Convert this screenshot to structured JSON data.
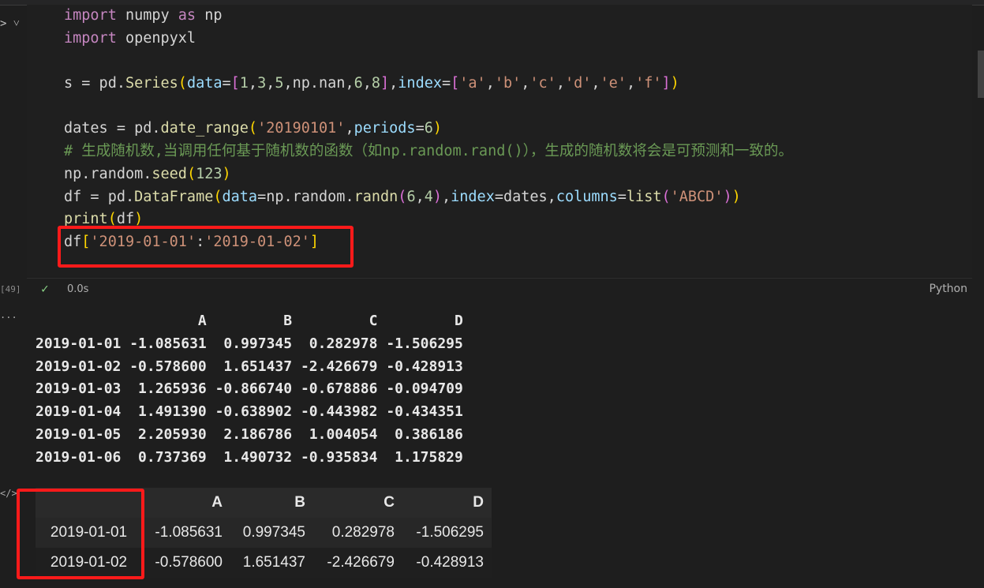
{
  "cell": {
    "code_lines": [
      [
        {
          "t": "import",
          "c": "kw"
        },
        {
          "t": " numpy ",
          "c": "op"
        },
        {
          "t": "as",
          "c": "kw"
        },
        {
          "t": " np",
          "c": "op"
        }
      ],
      [
        {
          "t": "import",
          "c": "kw"
        },
        {
          "t": " openpyxl",
          "c": "op"
        }
      ],
      [],
      [
        {
          "t": "s = pd.",
          "c": "op"
        },
        {
          "t": "Series",
          "c": "fn"
        },
        {
          "t": "(",
          "c": "br1"
        },
        {
          "t": "data",
          "c": "prm"
        },
        {
          "t": "=",
          "c": "op"
        },
        {
          "t": "[",
          "c": "br2"
        },
        {
          "t": "1",
          "c": "num"
        },
        {
          "t": ",",
          "c": "op"
        },
        {
          "t": "3",
          "c": "num"
        },
        {
          "t": ",",
          "c": "op"
        },
        {
          "t": "5",
          "c": "num"
        },
        {
          "t": ",np.nan,",
          "c": "op"
        },
        {
          "t": "6",
          "c": "num"
        },
        {
          "t": ",",
          "c": "op"
        },
        {
          "t": "8",
          "c": "num"
        },
        {
          "t": "]",
          "c": "br2"
        },
        {
          "t": ",",
          "c": "op"
        },
        {
          "t": "index",
          "c": "prm"
        },
        {
          "t": "=",
          "c": "op"
        },
        {
          "t": "[",
          "c": "br2"
        },
        {
          "t": "'a'",
          "c": "str"
        },
        {
          "t": ",",
          "c": "op"
        },
        {
          "t": "'b'",
          "c": "str"
        },
        {
          "t": ",",
          "c": "op"
        },
        {
          "t": "'c'",
          "c": "str"
        },
        {
          "t": ",",
          "c": "op"
        },
        {
          "t": "'d'",
          "c": "str"
        },
        {
          "t": ",",
          "c": "op"
        },
        {
          "t": "'e'",
          "c": "str"
        },
        {
          "t": ",",
          "c": "op"
        },
        {
          "t": "'f'",
          "c": "str"
        },
        {
          "t": "]",
          "c": "br2"
        },
        {
          "t": ")",
          "c": "br1"
        }
      ],
      [],
      [
        {
          "t": "dates = pd.",
          "c": "op"
        },
        {
          "t": "date_range",
          "c": "fn"
        },
        {
          "t": "(",
          "c": "br1"
        },
        {
          "t": "'20190101'",
          "c": "str"
        },
        {
          "t": ",",
          "c": "op"
        },
        {
          "t": "periods",
          "c": "prm"
        },
        {
          "t": "=",
          "c": "op"
        },
        {
          "t": "6",
          "c": "num"
        },
        {
          "t": ")",
          "c": "br1"
        }
      ],
      [
        {
          "t": "# 生成随机数,当调用任何基于随机数的函数（如np.random.rand()），生成的随机数将会是可预测和一致的。",
          "c": "cmt"
        }
      ],
      [
        {
          "t": "np.random.",
          "c": "op"
        },
        {
          "t": "seed",
          "c": "fn"
        },
        {
          "t": "(",
          "c": "br1"
        },
        {
          "t": "123",
          "c": "num"
        },
        {
          "t": ")",
          "c": "br1"
        }
      ],
      [
        {
          "t": "df = pd.",
          "c": "op"
        },
        {
          "t": "DataFrame",
          "c": "fn"
        },
        {
          "t": "(",
          "c": "br1"
        },
        {
          "t": "data",
          "c": "prm"
        },
        {
          "t": "=np.random.",
          "c": "op"
        },
        {
          "t": "randn",
          "c": "fn"
        },
        {
          "t": "(",
          "c": "br2"
        },
        {
          "t": "6",
          "c": "num"
        },
        {
          "t": ",",
          "c": "op"
        },
        {
          "t": "4",
          "c": "num"
        },
        {
          "t": ")",
          "c": "br2"
        },
        {
          "t": ",",
          "c": "op"
        },
        {
          "t": "index",
          "c": "prm"
        },
        {
          "t": "=dates,",
          "c": "op"
        },
        {
          "t": "columns",
          "c": "prm"
        },
        {
          "t": "=",
          "c": "op"
        },
        {
          "t": "list",
          "c": "fn"
        },
        {
          "t": "(",
          "c": "br2"
        },
        {
          "t": "'ABCD'",
          "c": "str"
        },
        {
          "t": ")",
          "c": "br2"
        },
        {
          "t": ")",
          "c": "br1"
        }
      ],
      [
        {
          "t": "print",
          "c": "fn"
        },
        {
          "t": "(",
          "c": "br1"
        },
        {
          "t": "df",
          "c": "op"
        },
        {
          "t": ")",
          "c": "br1"
        }
      ],
      [
        {
          "t": "df",
          "c": "op"
        },
        {
          "t": "[",
          "c": "br1"
        },
        {
          "t": "'2019-01-01'",
          "c": "str"
        },
        {
          "t": ":",
          "c": "op"
        },
        {
          "t": "'2019-01-02'",
          "c": "str"
        },
        {
          "t": "]",
          "c": "br1"
        }
      ]
    ],
    "exec_count": "[49]",
    "status_time": "0.0s",
    "language": "Python",
    "check_icon": "check-icon",
    "gutter_glyph": "> ˅"
  },
  "output": {
    "ellipsis": "...",
    "text_lines": [
      "                   A         B         C         D",
      "2019-01-01 -1.085631  0.997345  0.282978 -1.506295",
      "2019-01-02 -0.578600  1.651437 -2.426679 -0.428913",
      "2019-01-03  1.265936 -0.866740 -0.678886 -0.094709",
      "2019-01-04  1.491390 -0.638902 -0.443982 -0.434351",
      "2019-01-05  2.205930  2.186786  1.004054  0.386186",
      "2019-01-06  0.737369  1.490732 -0.935834  1.175829"
    ],
    "html_icon": "</>",
    "table": {
      "columns": [
        "",
        "A",
        "B",
        "C",
        "D"
      ],
      "rows": [
        [
          "2019-01-01",
          "-1.085631",
          "0.997345",
          "0.282978",
          "-1.506295"
        ],
        [
          "2019-01-02",
          "-0.578600",
          "1.651437",
          "-2.426679",
          "-0.428913"
        ]
      ]
    }
  },
  "colors": {
    "highlight": "#ff1a1a",
    "background": "#1e1e1e"
  }
}
